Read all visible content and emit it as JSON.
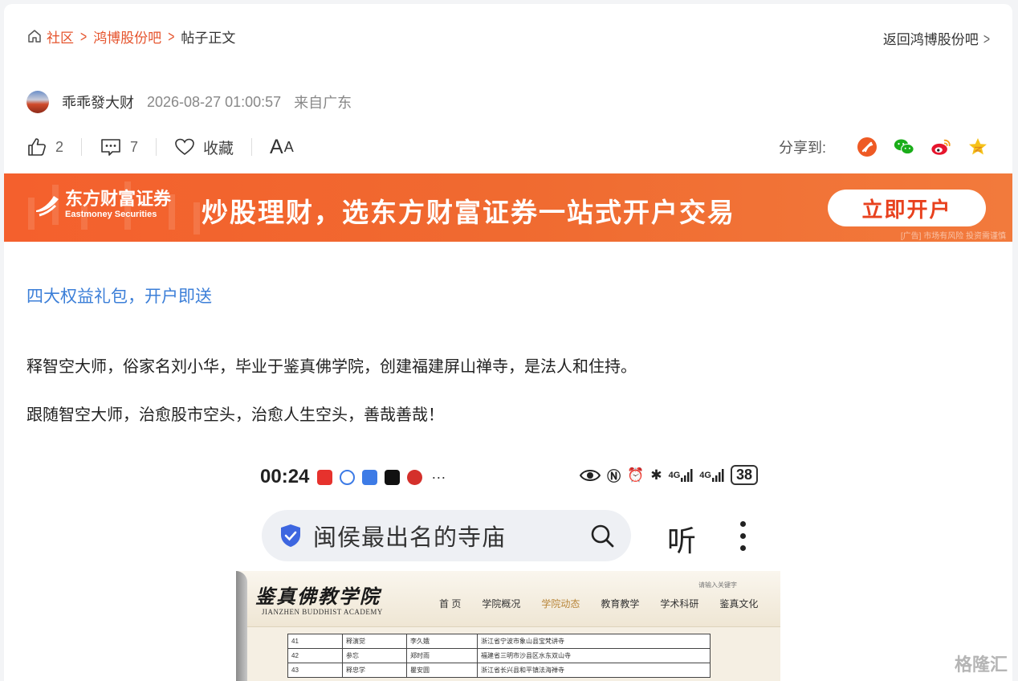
{
  "breadcrumb": {
    "items": [
      "社区",
      "鸿博股份吧"
    ],
    "current": "帖子正文",
    "back_link": "返回鸿博股份吧"
  },
  "post": {
    "author": "乖乖發大财",
    "datetime": "2026-08-27 01:00:57",
    "location": "来自广东"
  },
  "actions": {
    "likes": "2",
    "comments": "7",
    "favorite_label": "收藏",
    "font_label": "A",
    "font_label_small": "A",
    "share_label": "分享到:"
  },
  "banner": {
    "brand_cn": "东方财富证券",
    "brand_en": "Eastmoney Securities",
    "slogan": "炒股理财，选东方财富证券一站式开户交易",
    "button": "立即开户",
    "risk_note": "[广告] 市场有风险 投资需谨慎"
  },
  "content": {
    "promo_link": "四大权益礼包，开户即送",
    "paragraph_1": "释智空大师，俗家名刘小华，毕业于鉴真佛学院，创建福建屏山禅寺，是法人和住持。",
    "paragraph_2": "跟随智空大师，治愈股市空头，治愈人生空头，善哉善哉！"
  },
  "screenshot": {
    "time": "00:24",
    "battery": "38",
    "network_1": "4G",
    "network_2": "4G",
    "search_query": "闽侯最出名的寺庙",
    "listen_label": "听",
    "site_name": "鉴真佛教学院",
    "site_name_en": "JIANZHEN BUDDHIST ACADEMY",
    "search_hint": "请输入关键字",
    "nav": [
      "首 页",
      "学院概况",
      "学院动态",
      "教育教学",
      "学术科研",
      "鉴真文化"
    ],
    "table_rows": [
      [
        "41",
        "释演觉",
        "李久娥",
        "浙江省宁波市象山县宝梵讲寺"
      ],
      [
        "42",
        "参忘",
        "郑时雨",
        "福建省三明市沙县区水东双山寺"
      ],
      [
        "43",
        "释忠学",
        "瞿安圆",
        "浙江省长兴县和平镇法海禅寺"
      ]
    ]
  },
  "watermark": "格隆汇",
  "colors": {
    "accent": "#e5532c",
    "link": "#3c7fd8",
    "banner": "#f4602d"
  }
}
